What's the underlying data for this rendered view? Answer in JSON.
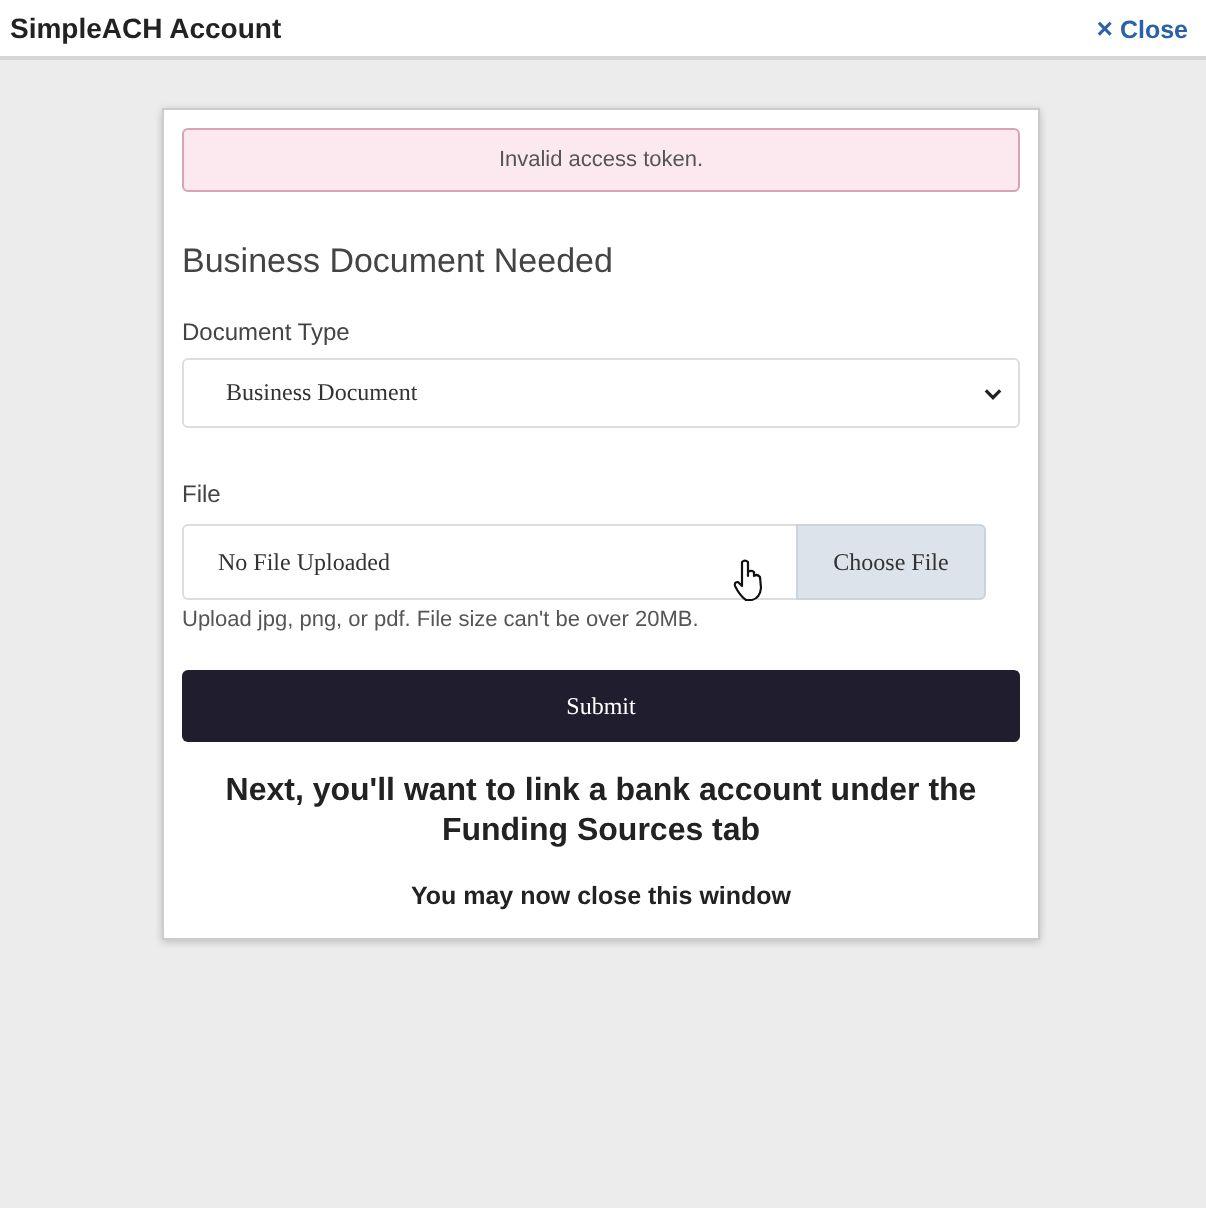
{
  "window": {
    "title": "SimpleACH Account",
    "close": {
      "icon": "×",
      "label": "Close"
    }
  },
  "alert": {
    "kind": "error",
    "text": "Invalid access token."
  },
  "form": {
    "title": "Business Document Needed",
    "document_type": {
      "label": "Document Type",
      "value": "Business Document"
    },
    "file": {
      "label": "File",
      "value": "No File Uploaded",
      "button": "Choose File",
      "help": "Upload jpg, png, or pdf. File size can't be over 20MB."
    },
    "submit": "Submit"
  },
  "next_step": "Next, you'll want to link a bank account under the Funding Sources tab",
  "note": "You may now close this window"
}
